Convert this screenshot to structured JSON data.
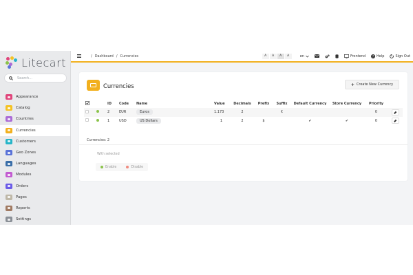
{
  "brand": {
    "name": "Litecart"
  },
  "search": {
    "placeholder": "Search..."
  },
  "sidebar": {
    "items": [
      {
        "label": "Appearance",
        "color": "#e0457b",
        "active": false
      },
      {
        "label": "Catalog",
        "color": "#f4c223",
        "active": false
      },
      {
        "label": "Countries",
        "color": "#ab6cd6",
        "active": false
      },
      {
        "label": "Currencies",
        "color": "#f2b01e",
        "active": true
      },
      {
        "label": "Customers",
        "color": "#27b5c8",
        "active": false
      },
      {
        "label": "Geo Zones",
        "color": "#5a73d8",
        "active": false
      },
      {
        "label": "Languages",
        "color": "#3a6ea8",
        "active": false
      },
      {
        "label": "Modules",
        "color": "#c35cd1",
        "active": false
      },
      {
        "label": "Orders",
        "color": "#6c5ce7",
        "active": false
      },
      {
        "label": "Pages",
        "color": "#bfb8a8",
        "active": false
      },
      {
        "label": "Reports",
        "color": "#a07a62",
        "active": false
      },
      {
        "label": "Settings",
        "color": "#8a8f96",
        "active": false
      }
    ]
  },
  "topbar": {
    "breadcrumb": [
      "/",
      "Dashboard",
      "/",
      "Currencies"
    ],
    "text_sizes": [
      "A",
      "A",
      "A",
      "A"
    ],
    "language": "en",
    "frontend": "Frontend",
    "help": "Help",
    "sign_out": "Sign Out"
  },
  "page": {
    "title": "Currencies",
    "create_button": "Create New Currency",
    "columns": [
      "ID",
      "Code",
      "Name",
      "Value",
      "Decimals",
      "Prefix",
      "Suffix",
      "Default Currency",
      "Store Currency",
      "Priority"
    ],
    "rows": [
      {
        "id": "2",
        "code": "EUR",
        "name": "Euros",
        "value": "1.173",
        "decimals": "2",
        "prefix": "",
        "suffix": "€",
        "default": "",
        "store": "",
        "priority": "0",
        "status_color": "#8bc34a"
      },
      {
        "id": "1",
        "code": "USD",
        "name": "US Dollars",
        "value": "1",
        "decimals": "2",
        "prefix": "$",
        "suffix": "",
        "default": "✔",
        "store": "✔",
        "priority": "0",
        "status_color": "#8bc34a"
      }
    ],
    "count_text": "Currencies: 2",
    "with_selected": "With selected",
    "enable": "Enable",
    "disable": "Disable"
  },
  "colors": {
    "accent": "#f2b01e",
    "enable_dot": "#8bc34a",
    "disable_dot": "#f08a7e"
  }
}
